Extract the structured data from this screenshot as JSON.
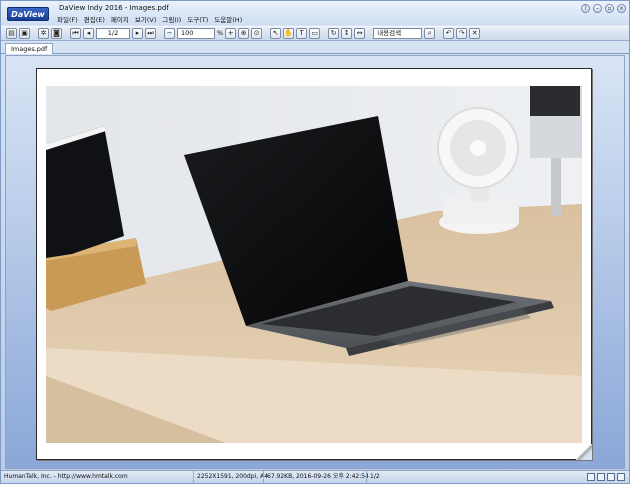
{
  "app": {
    "logo": "DaView",
    "title": "DaView Indy 2016 - Images.pdf"
  },
  "menu": [
    "파일(F)",
    "편집(E)",
    "페이지",
    "보기(V)",
    "그림(I)",
    "도구(T)",
    "도움말(H)"
  ],
  "toolbar": {
    "page_value": "1/2",
    "zoom_value": "100",
    "zoom_unit": "%",
    "search_value": "내용검색"
  },
  "tabs": [
    "Images.pdf"
  ],
  "status": {
    "company": "HumanTalk, Inc. - http://www.hmtalk.com",
    "image_info": "2252X1591, 200dpi, A4",
    "file_info": "67.92KB, 2016-09-26 오후 2:42:54",
    "page": "1/2"
  },
  "icons": {
    "window": [
      "help-icon",
      "minimize-icon",
      "restore-icon",
      "close-icon"
    ],
    "toolbar": [
      "save-icon",
      "print-icon",
      "settings-icon",
      "full-screen-icon",
      "first-page-icon",
      "previous-page-icon",
      "next-page-icon",
      "last-page-icon",
      "zoom-out-icon",
      "zoom-in-icon",
      "zoom-fit-icon",
      "zoom-reset-icon",
      "pointer-icon",
      "hand-icon",
      "text-select-icon",
      "snapshot-icon",
      "rotate-icon",
      "fit-height-icon",
      "fit-width-icon",
      "search-icon",
      "undo-icon",
      "redo-icon",
      "close-document-icon"
    ]
  }
}
